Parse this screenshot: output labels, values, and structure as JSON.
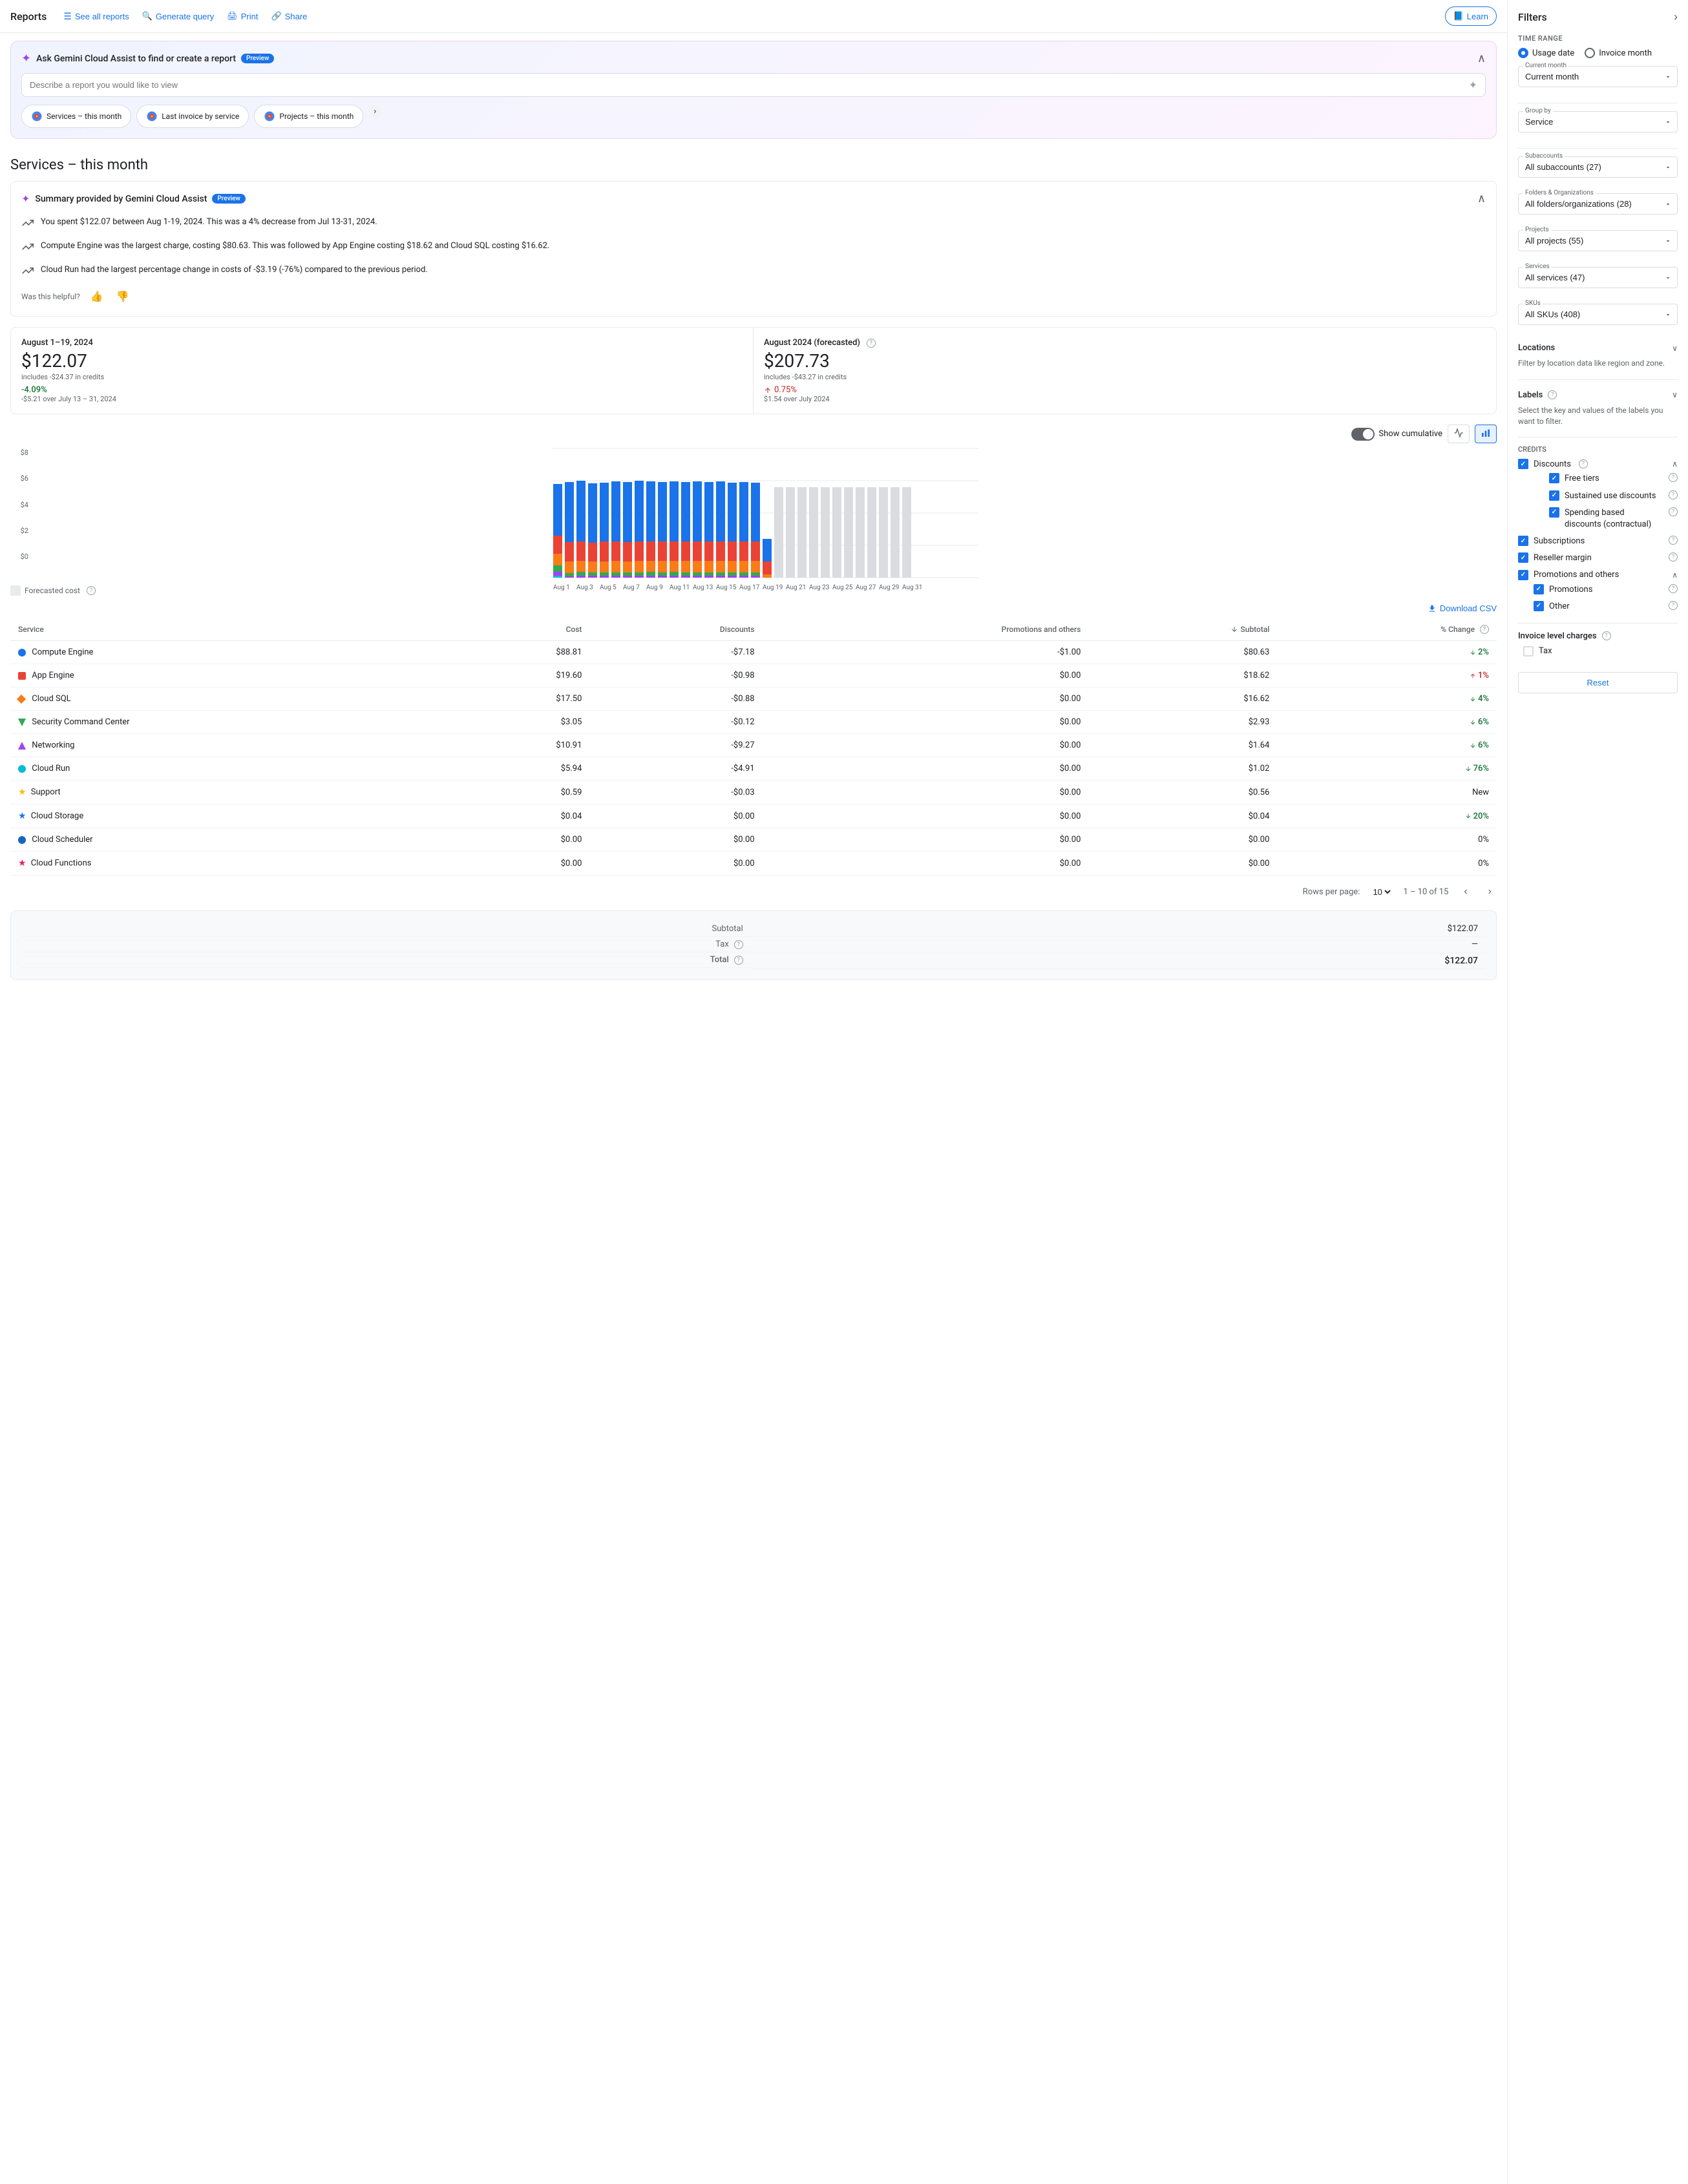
{
  "nav": {
    "title": "Reports",
    "buttons": [
      {
        "id": "see-all-reports",
        "label": "See all reports",
        "icon": "☰"
      },
      {
        "id": "generate-query",
        "label": "Generate query",
        "icon": "🔍"
      },
      {
        "id": "print",
        "label": "Print",
        "icon": "🖨"
      },
      {
        "id": "share",
        "label": "Share",
        "icon": "🔗"
      },
      {
        "id": "learn",
        "label": "Learn",
        "icon": "📘"
      }
    ]
  },
  "gemini": {
    "title": "Ask Gemini Cloud Assist to find or create a report",
    "preview_badge": "Preview",
    "input_placeholder": "Describe a report you would like to view",
    "chips": [
      {
        "label": "Services – this month"
      },
      {
        "label": "Last invoice by service"
      },
      {
        "label": "Projects – this month"
      }
    ]
  },
  "page_title": "Services – this month",
  "summary": {
    "title": "Summary provided by Gemini Cloud Assist",
    "preview_badge": "Preview",
    "bullets": [
      "You spent $122.07 between Aug 1-19, 2024. This was a 4% decrease from Jul 13-31, 2024.",
      "Compute Engine was the largest charge, costing $80.63. This was followed by App Engine costing $18.62 and Cloud SQL costing $16.62.",
      "Cloud Run had the largest percentage change in costs of -$3.19 (-76%) compared to the previous period."
    ],
    "helpful_label": "Was this helpful?"
  },
  "stats": {
    "current": {
      "period": "August 1–19, 2024",
      "amount": "$122.07",
      "sub": "includes -$24.37 in credits",
      "change": "-4.09%",
      "change_type": "down",
      "change_sub": "-$5.21 over July 13 – 31, 2024"
    },
    "forecast": {
      "period": "August 2024 (forecasted)",
      "amount": "$207.73",
      "sub": "includes -$43.27 in credits",
      "change": "0.75%",
      "change_type": "up",
      "change_sub": "$1.54 over July 2024"
    }
  },
  "chart": {
    "y_labels": [
      "$8",
      "$6",
      "$4",
      "$2",
      "$0"
    ],
    "show_cumulative_label": "Show cumulative",
    "forecasted_cost_label": "Forecasted cost"
  },
  "table": {
    "download_label": "Download CSV",
    "headers": [
      "Service",
      "Cost",
      "Discounts",
      "Promotions and others",
      "Subtotal",
      "% Change"
    ],
    "rows": [
      {
        "service": "Compute Engine",
        "icon_class": "icon-blue",
        "icon_shape": "circle",
        "cost": "$88.81",
        "discounts": "-$7.18",
        "promotions": "-$1.00",
        "subtotal": "$80.63",
        "change": "2%",
        "change_type": "down"
      },
      {
        "service": "App Engine",
        "icon_class": "icon-red",
        "icon_shape": "square",
        "cost": "$19.60",
        "discounts": "-$0.98",
        "promotions": "$0.00",
        "subtotal": "$18.62",
        "change": "1%",
        "change_type": "up"
      },
      {
        "service": "Cloud SQL",
        "icon_class": "icon-orange",
        "icon_shape": "diamond",
        "cost": "$17.50",
        "discounts": "-$0.88",
        "promotions": "$0.00",
        "subtotal": "$16.62",
        "change": "4%",
        "change_type": "down"
      },
      {
        "service": "Security Command Center",
        "icon_class": "icon-green",
        "icon_shape": "triangle-down",
        "cost": "$3.05",
        "discounts": "-$0.12",
        "promotions": "$0.00",
        "subtotal": "$2.93",
        "change": "6%",
        "change_type": "down"
      },
      {
        "service": "Networking",
        "icon_class": "icon-purple",
        "icon_shape": "triangle",
        "cost": "$10.91",
        "discounts": "-$9.27",
        "promotions": "$0.00",
        "subtotal": "$1.64",
        "change": "6%",
        "change_type": "down"
      },
      {
        "service": "Cloud Run",
        "icon_class": "icon-teal",
        "icon_shape": "circle",
        "cost": "$5.94",
        "discounts": "-$4.91",
        "promotions": "$0.00",
        "subtotal": "$1.02",
        "change": "76%",
        "change_type": "down"
      },
      {
        "service": "Support",
        "icon_class": "icon-yellow",
        "icon_shape": "star",
        "cost": "$0.59",
        "discounts": "-$0.03",
        "promotions": "$0.00",
        "subtotal": "$0.56",
        "change": "New",
        "change_type": "neutral"
      },
      {
        "service": "Cloud Storage",
        "icon_class": "icon-blue",
        "icon_shape": "star2",
        "cost": "$0.04",
        "discounts": "$0.00",
        "promotions": "$0.00",
        "subtotal": "$0.04",
        "change": "20%",
        "change_type": "down"
      },
      {
        "service": "Cloud Scheduler",
        "icon_class": "icon-navy",
        "icon_shape": "circle",
        "cost": "$0.00",
        "discounts": "$0.00",
        "promotions": "$0.00",
        "subtotal": "$0.00",
        "change": "0%",
        "change_type": "neutral"
      },
      {
        "service": "Cloud Functions",
        "icon_class": "icon-pink",
        "icon_shape": "star",
        "cost": "$0.00",
        "discounts": "$0.00",
        "promotions": "$0.00",
        "subtotal": "$0.00",
        "change": "0%",
        "change_type": "neutral"
      }
    ],
    "pagination": {
      "rows_per_page_label": "Rows per page:",
      "rows_per_page": "10",
      "range": "1 – 10 of 15"
    }
  },
  "totals": {
    "subtotal_label": "Subtotal",
    "subtotal_value": "$122.07",
    "tax_label": "Tax",
    "tax_value": "—",
    "total_label": "Total",
    "total_value": "$122.07"
  },
  "filters": {
    "title": "Filters",
    "time_range_label": "Time range",
    "usage_date_label": "Usage date",
    "invoice_month_label": "Invoice month",
    "current_month_label": "Current month",
    "group_by_label": "Group by",
    "group_by_value": "Service",
    "subaccounts_label": "Subaccounts",
    "subaccounts_value": "All subaccounts (27)",
    "folders_label": "Folders & Organizations",
    "folders_value": "All folders/organizations (28)",
    "projects_label": "Projects",
    "projects_value": "All projects (55)",
    "services_label": "Services",
    "services_value": "All services (47)",
    "skus_label": "SKUs",
    "skus_value": "All SKUs (408)",
    "locations_label": "Locations",
    "locations_note": "Filter by location data like region and zone.",
    "labels_label": "Labels",
    "labels_note": "Select the key and values of the labels you want to filter.",
    "credits_label": "Credits",
    "discounts_label": "Discounts",
    "free_tiers_label": "Free tiers",
    "sustained_use_label": "Sustained use discounts",
    "spending_based_label": "Spending based discounts (contractual)",
    "subscriptions_label": "Subscriptions",
    "reseller_margin_label": "Reseller margin",
    "promotions_and_others_label": "Promotions and others",
    "promotions_label": "Promotions",
    "other_label": "Other",
    "invoice_level_label": "Invoice level charges",
    "tax_label": "Tax",
    "reset_label": "Reset"
  }
}
